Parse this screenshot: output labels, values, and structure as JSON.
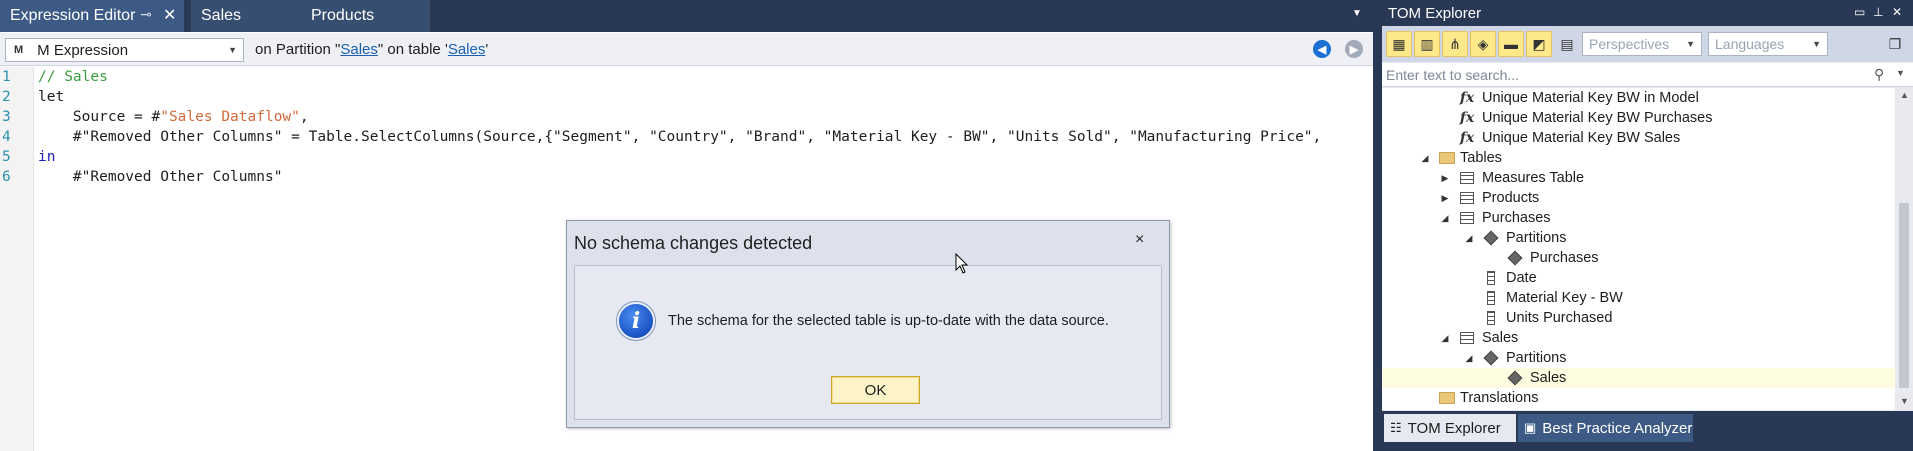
{
  "editor": {
    "tabs": [
      {
        "label": "Expression Editor"
      },
      {
        "label": "Sales"
      },
      {
        "label": "Products"
      }
    ],
    "expression_type": "M Expression",
    "expression_badge": "M",
    "partition_prefix": "on Partition \"",
    "partition_name": "Sales",
    "partition_middle": "\" on table '",
    "table_name": "Sales",
    "partition_suffix": "'",
    "line_numbers": [
      "1",
      "2",
      "3",
      "4",
      "5",
      "6"
    ],
    "code": {
      "line1": "// Sales",
      "line2": "let",
      "line3_pre": "    Source = #",
      "line3_str": "\"Sales Dataflow\"",
      "line3_post": ",",
      "line4": "    #\"Removed Other Columns\" = Table.SelectColumns(Source,{\"Segment\", \"Country\", \"Brand\", \"Material Key - BW\", \"Units Sold\", \"Manufacturing Price\",",
      "line5": "in",
      "line6": "    #\"Removed Other Columns\""
    }
  },
  "dialog": {
    "title": "No schema changes detected",
    "message": "The schema for the selected table is up-to-date with the data source.",
    "ok_label": "OK",
    "close_glyph": "×",
    "info_glyph": "i"
  },
  "tom_explorer": {
    "title": "TOM Explorer",
    "perspectives_placeholder": "Perspectives",
    "languages_placeholder": "Languages",
    "search_placeholder": "Enter text to search...",
    "tree": [
      {
        "label": "Unique Material Key BW in Model",
        "icon": "fx"
      },
      {
        "label": "Unique Material Key BW Purchases",
        "icon": "fx"
      },
      {
        "label": "Unique Material Key BW Sales",
        "icon": "fx"
      },
      {
        "label": "Tables",
        "icon": "folder"
      },
      {
        "label": "Measures Table",
        "icon": "table"
      },
      {
        "label": "Products",
        "icon": "table"
      },
      {
        "label": "Purchases",
        "icon": "table"
      },
      {
        "label": "Partitions",
        "icon": "cube"
      },
      {
        "label": "Purchases",
        "icon": "cube"
      },
      {
        "label": "Date",
        "icon": "column"
      },
      {
        "label": "Material Key - BW",
        "icon": "column"
      },
      {
        "label": "Units Purchased",
        "icon": "column"
      },
      {
        "label": "Sales",
        "icon": "table"
      },
      {
        "label": "Partitions",
        "icon": "cube"
      },
      {
        "label": "Sales",
        "icon": "cube"
      },
      {
        "label": "Translations",
        "icon": "folder"
      }
    ],
    "bottom_tabs": [
      {
        "label": "TOM Explorer"
      },
      {
        "label": "Best Practice Analyzer"
      }
    ]
  },
  "colors": {
    "chrome_dark": "#293955",
    "active_tab": "#3c5a84",
    "toolbar_active": "#fde88a",
    "link": "#1a5fb4",
    "comment": "#3a9e3a",
    "string": "#d36a3c",
    "keyword": "#2020c0"
  }
}
